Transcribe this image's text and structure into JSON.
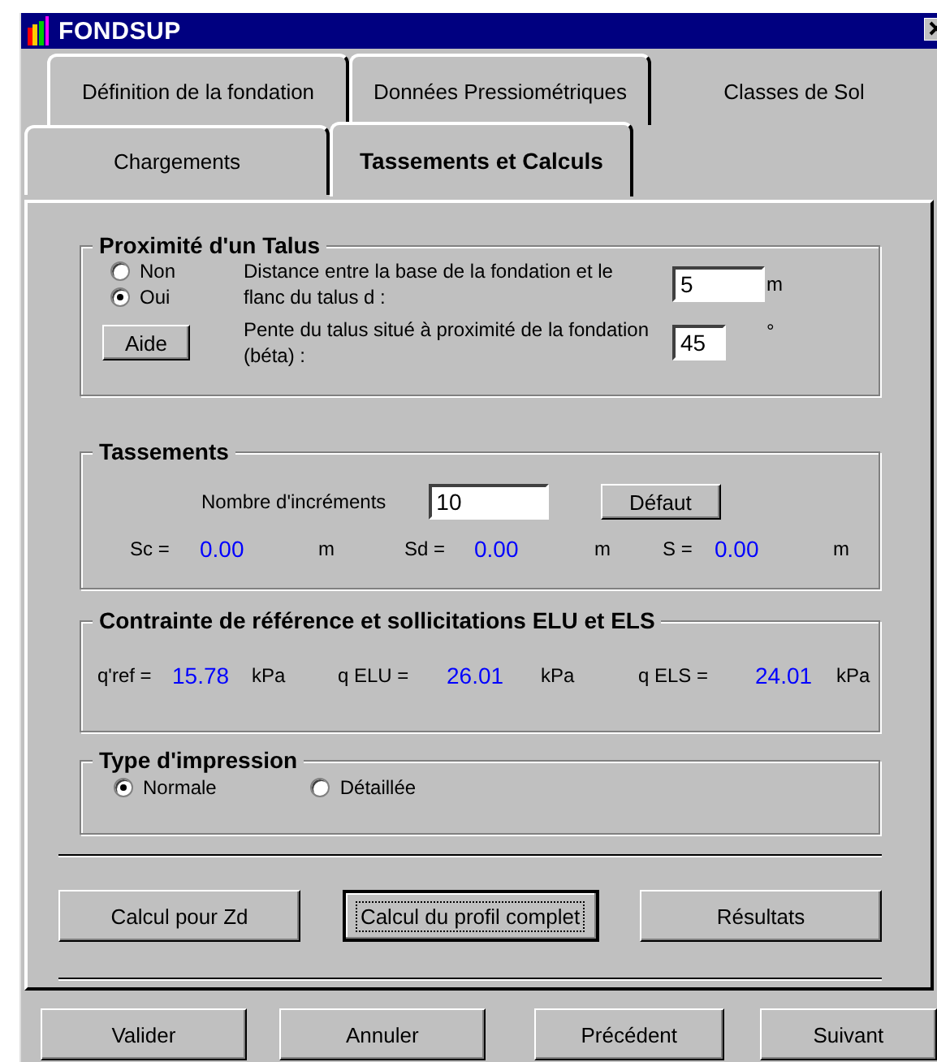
{
  "window": {
    "title": "FONDSUP"
  },
  "tab_rows": [
    {
      "tabs": [
        {
          "label": "Définition de la fondation",
          "selected": false
        },
        {
          "label": "Données Pressiométriques",
          "selected": false
        },
        {
          "label": "Classes de Sol",
          "selected": false
        }
      ]
    },
    {
      "tabs": [
        {
          "label": "Chargements",
          "selected": false
        },
        {
          "label": "Tassements et Calculs",
          "selected": true
        }
      ]
    }
  ],
  "proximite": {
    "title": "Proximité d'un Talus",
    "options": [
      {
        "label": "Non",
        "selected": false
      },
      {
        "label": "Oui",
        "selected": true
      }
    ],
    "help_button": "Aide",
    "fields": [
      {
        "label": "Distance entre la base de la fondation et le flanc du talus d :",
        "value": "5",
        "unit": "m"
      },
      {
        "label": "Pente du talus situé à proximité de la fondation (béta) :",
        "value": "45",
        "unit": "°"
      }
    ]
  },
  "tassements": {
    "title": "Tassements",
    "increments": {
      "label": "Nombre d'incréments",
      "value": "10"
    },
    "default_button": "Défaut",
    "results": [
      {
        "label": "Sc =",
        "value": "0.00",
        "unit": "m"
      },
      {
        "label": "Sd =",
        "value": "0.00",
        "unit": "m"
      },
      {
        "label": "S =",
        "value": "0.00",
        "unit": "m"
      }
    ]
  },
  "contrainte": {
    "title": "Contrainte de référence et sollicitations ELU et ELS",
    "results": [
      {
        "label": "q'ref =",
        "value": "15.78",
        "unit": "kPa"
      },
      {
        "label": "q ELU =",
        "value": "26.01",
        "unit": "kPa"
      },
      {
        "label": "q ELS =",
        "value": "24.01",
        "unit": "kPa"
      }
    ]
  },
  "impression": {
    "title": "Type d'impression",
    "options": [
      {
        "label": "Normale",
        "selected": true
      },
      {
        "label": "Détaillée",
        "selected": false
      }
    ]
  },
  "actions": [
    {
      "label": "Calcul pour Zd",
      "focused": false
    },
    {
      "label": "Calcul du profil complet",
      "focused": true
    },
    {
      "label": "Résultats",
      "focused": false
    }
  ],
  "footer_buttons": [
    "Valider",
    "Annuler",
    "Précédent",
    "Suivant"
  ]
}
